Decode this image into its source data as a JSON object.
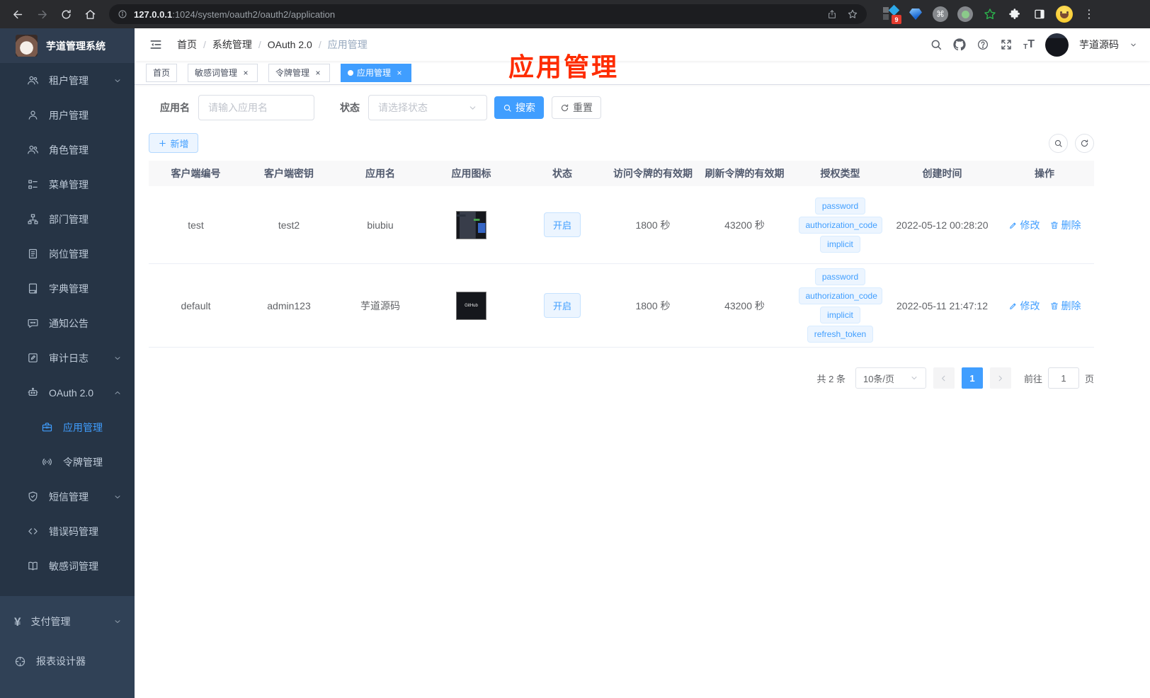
{
  "browser": {
    "url_host": "127.0.0.1",
    "url_rest": ":1024/system/oauth2/oauth2/application",
    "extension_badge": "9"
  },
  "sidebar": {
    "title": "芋道管理系统",
    "menu": [
      {
        "label": "租户管理",
        "icon": "users",
        "level": 1,
        "chevron": "down"
      },
      {
        "label": "用户管理",
        "icon": "user",
        "level": 1
      },
      {
        "label": "角色管理",
        "icon": "users",
        "level": 1
      },
      {
        "label": "菜单管理",
        "icon": "tree",
        "level": 1
      },
      {
        "label": "部门管理",
        "icon": "org",
        "level": 1
      },
      {
        "label": "岗位管理",
        "icon": "badge",
        "level": 1
      },
      {
        "label": "字典管理",
        "icon": "dict",
        "level": 1
      },
      {
        "label": "通知公告",
        "icon": "notice",
        "level": 1
      },
      {
        "label": "审计日志",
        "icon": "audit",
        "level": 1,
        "chevron": "down"
      },
      {
        "label": "OAuth 2.0",
        "icon": "robot",
        "level": 1,
        "chevron": "up"
      },
      {
        "label": "应用管理",
        "icon": "briefcase",
        "level": 2,
        "active": true
      },
      {
        "label": "令牌管理",
        "icon": "broadcast",
        "level": 2
      },
      {
        "label": "短信管理",
        "icon": "shield",
        "level": 1,
        "chevron": "down"
      },
      {
        "label": "错误码管理",
        "icon": "code",
        "level": 1
      },
      {
        "label": "敏感词管理",
        "icon": "book",
        "level": 1
      }
    ],
    "bottom_menu": [
      {
        "label": "支付管理",
        "icon": "yen",
        "level": 0,
        "chevron": "down"
      },
      {
        "label": "报表设计器",
        "icon": "report",
        "level": 0
      }
    ]
  },
  "header": {
    "breadcrumb": [
      "首页",
      "系统管理",
      "OAuth 2.0",
      "应用管理"
    ],
    "user_name": "芋道源码"
  },
  "tabs": [
    {
      "label": "首页",
      "closable": false,
      "active": false
    },
    {
      "label": "敏感词管理",
      "closable": true,
      "active": false
    },
    {
      "label": "令牌管理",
      "closable": true,
      "active": false
    },
    {
      "label": "应用管理",
      "closable": true,
      "active": true
    }
  ],
  "annotation": {
    "text": "应用管理",
    "color": "#fe2c00"
  },
  "filter": {
    "name_label": "应用名",
    "name_placeholder": "请输入应用名",
    "status_label": "状态",
    "status_placeholder": "请选择状态",
    "search_label": "搜索",
    "reset_label": "重置",
    "add_label": "新增"
  },
  "table": {
    "columns": [
      "客户端编号",
      "客户端密钥",
      "应用名",
      "应用图标",
      "状态",
      "访问令牌的有效期",
      "刷新令牌的有效期",
      "授权类型",
      "创建时间",
      "操作"
    ],
    "action_edit": "修改",
    "action_delete": "删除",
    "rows": [
      {
        "client_id": "test",
        "secret": "test2",
        "name": "biubiu",
        "icon_text": "",
        "status": "开启",
        "access_token_validity": "1800 秒",
        "refresh_token_validity": "43200 秒",
        "grant_types": [
          "password",
          "authorization_code",
          "implicit"
        ],
        "create_time": "2022-05-12 00:28:20"
      },
      {
        "client_id": "default",
        "secret": "admin123",
        "name": "芋道源码",
        "icon_text": "GitHub",
        "status": "开启",
        "access_token_validity": "1800 秒",
        "refresh_token_validity": "43200 秒",
        "grant_types": [
          "password",
          "authorization_code",
          "implicit",
          "refresh_token"
        ],
        "create_time": "2022-05-11 21:47:12"
      }
    ]
  },
  "pagination": {
    "total": "共 2 条",
    "page_size": "10条/页",
    "page": "1",
    "goto_label": "前往",
    "goto_value": "1",
    "goto_suffix": "页"
  },
  "colors": {
    "accent": "#409eff",
    "annotation_red": "#fe2c00"
  }
}
